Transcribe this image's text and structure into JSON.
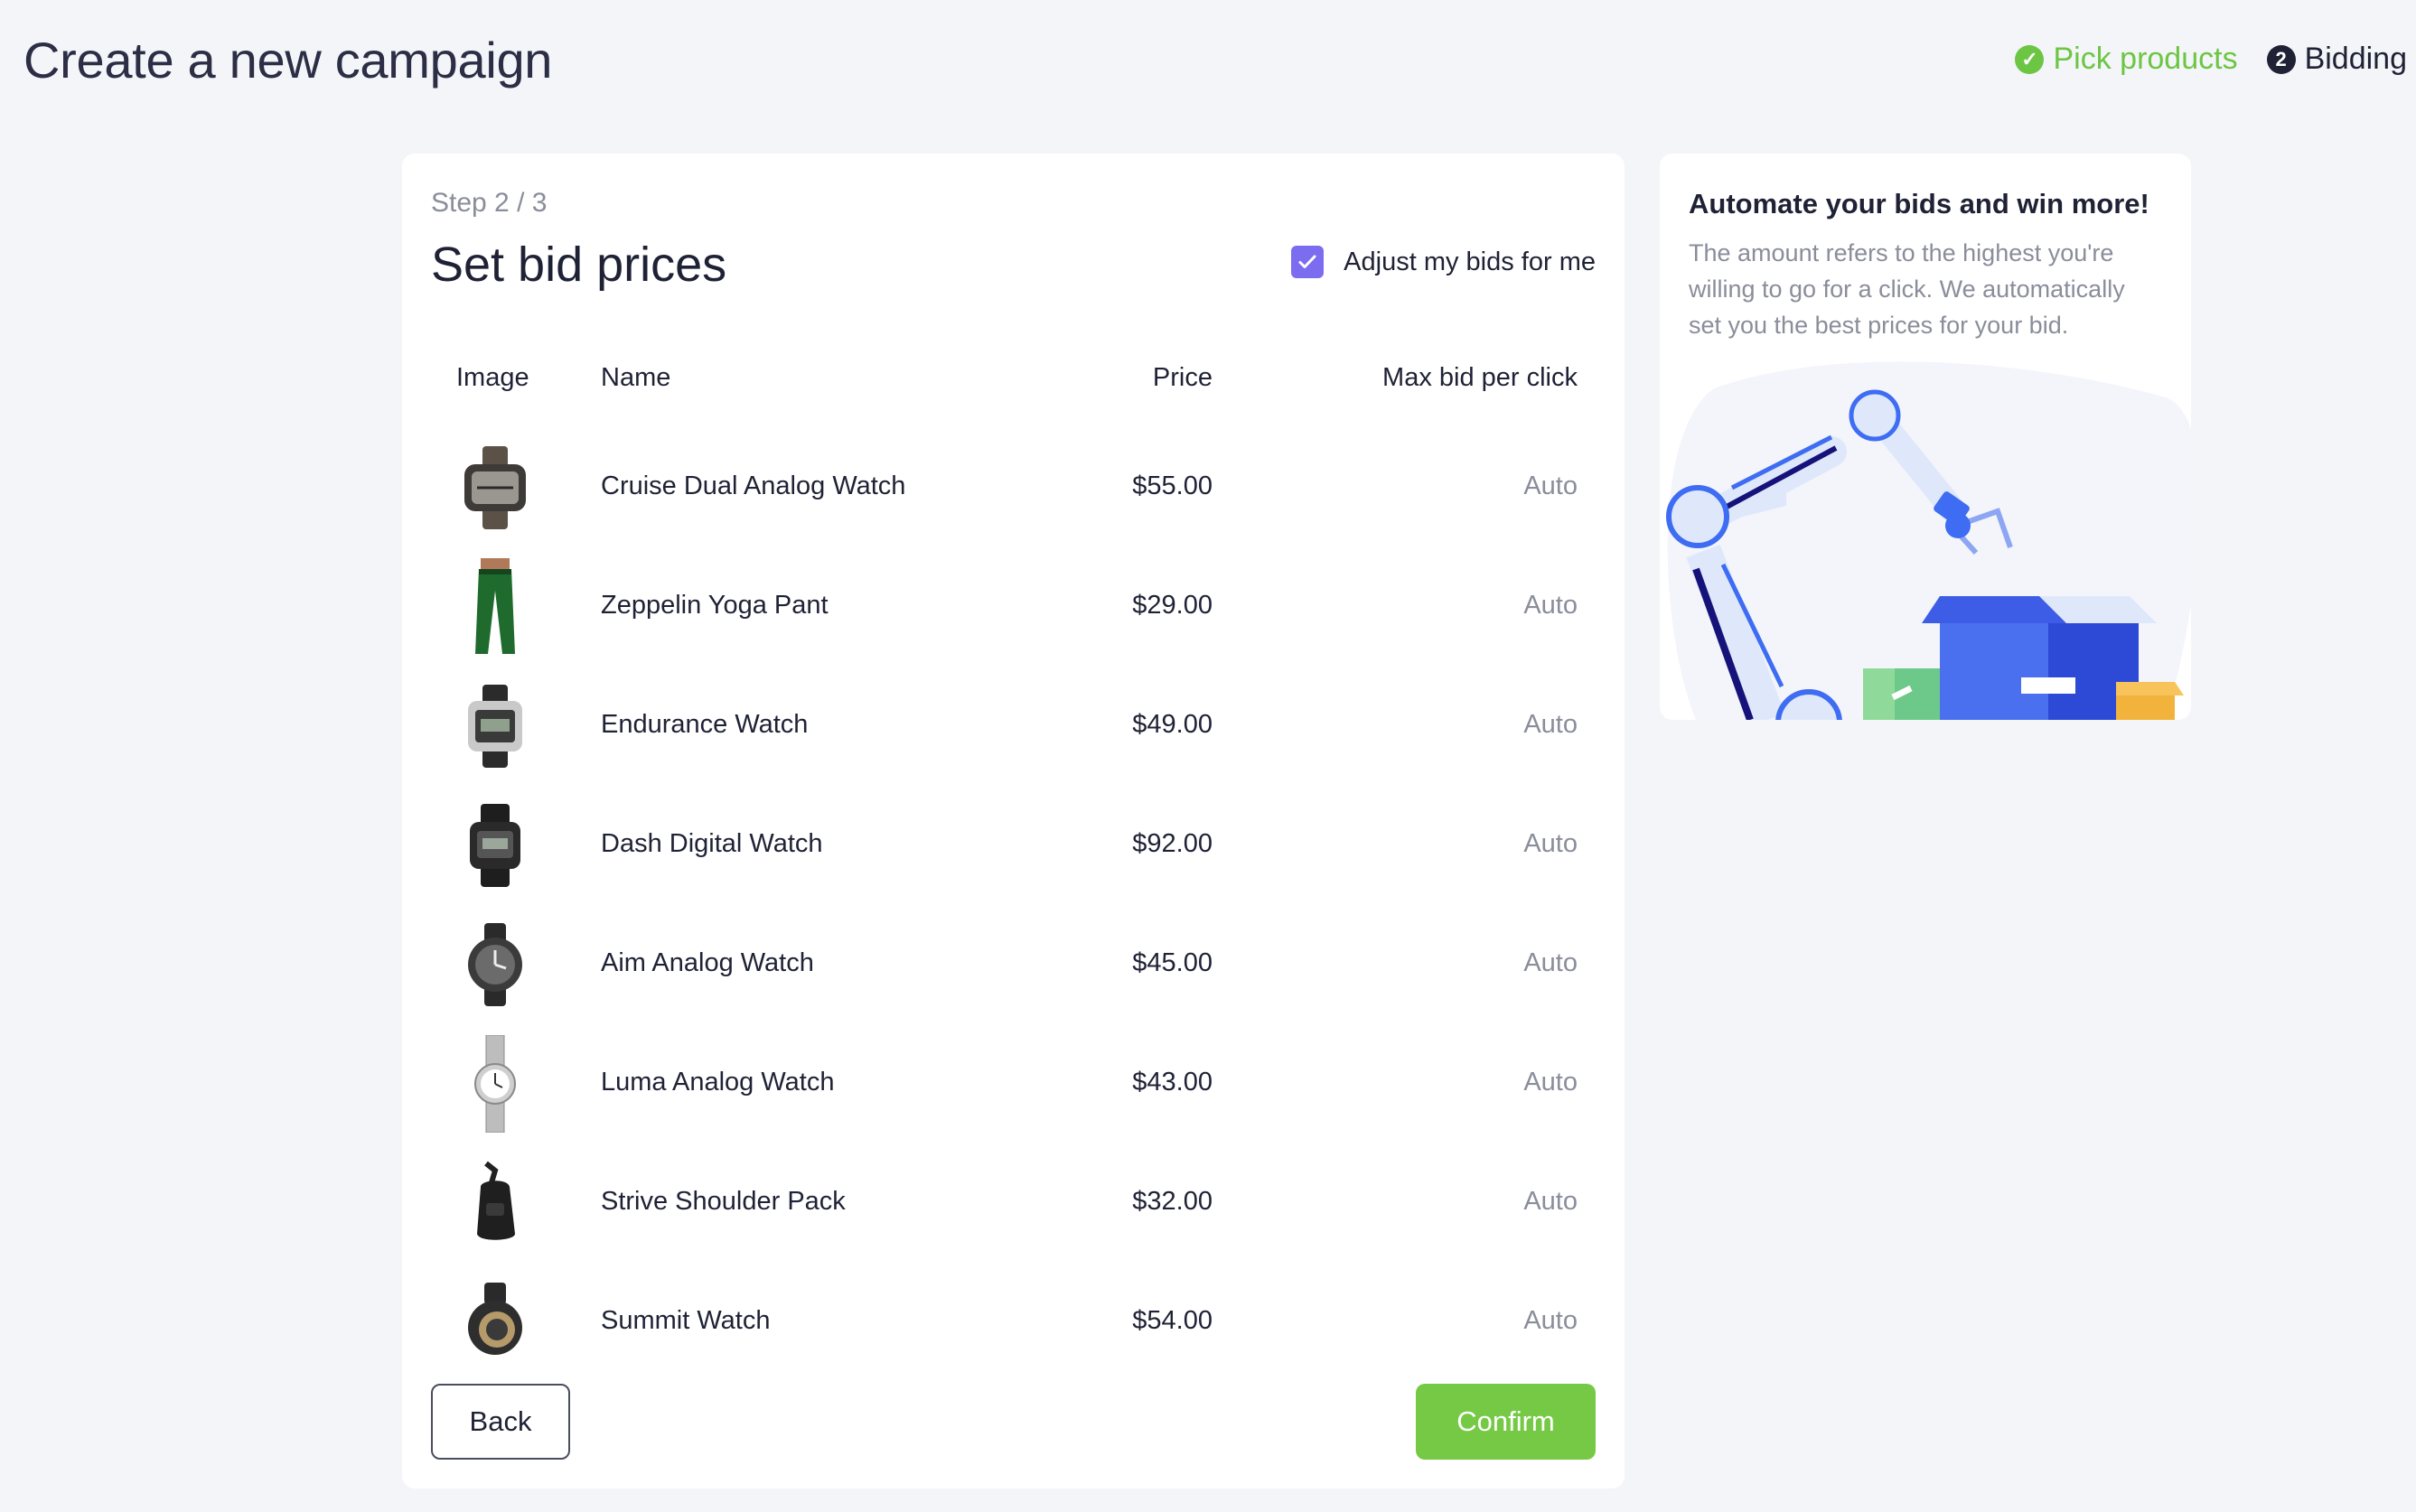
{
  "page": {
    "title": "Create a new campaign"
  },
  "stepper": {
    "steps": [
      {
        "label": "Pick products",
        "status": "done",
        "marker": "✓"
      },
      {
        "label": "Bidding",
        "status": "current",
        "marker": "2"
      }
    ]
  },
  "main": {
    "step_label": "Step 2 / 3",
    "title": "Set bid prices",
    "auto_adjust": {
      "label": "Adjust my bids for me",
      "checked": true
    },
    "columns": {
      "image": "Image",
      "name": "Name",
      "price": "Price",
      "max_bid": "Max bid per click"
    },
    "products": [
      {
        "name": "Cruise Dual Analog Watch",
        "price": "$55.00",
        "max_bid": "Auto",
        "thumb": "watch-icon"
      },
      {
        "name": "Zeppelin Yoga Pant",
        "price": "$29.00",
        "max_bid": "Auto",
        "thumb": "pants-icon"
      },
      {
        "name": "Endurance Watch",
        "price": "$49.00",
        "max_bid": "Auto",
        "thumb": "watch-icon"
      },
      {
        "name": "Dash Digital Watch",
        "price": "$92.00",
        "max_bid": "Auto",
        "thumb": "watch-icon"
      },
      {
        "name": "Aim Analog Watch",
        "price": "$45.00",
        "max_bid": "Auto",
        "thumb": "watch-icon"
      },
      {
        "name": "Luma Analog Watch",
        "price": "$43.00",
        "max_bid": "Auto",
        "thumb": "watch-icon"
      },
      {
        "name": "Strive Shoulder Pack",
        "price": "$32.00",
        "max_bid": "Auto",
        "thumb": "bag-icon"
      },
      {
        "name": "Summit Watch",
        "price": "$54.00",
        "max_bid": "Auto",
        "thumb": "watch-icon"
      }
    ],
    "back_label": "Back",
    "confirm_label": "Confirm"
  },
  "sidebar": {
    "title": "Automate your bids and win more!",
    "text": "The amount refers to the highest you're willing to go for a click. We automatically set you the best prices for your bid.",
    "illustration": "robot-arm-illustration"
  },
  "colors": {
    "accent_green": "#75c945",
    "checkbox_purple": "#7b6cf0",
    "text_dark": "#1f2235",
    "text_muted": "#8a8d9a",
    "background": "#f4f5f8"
  }
}
